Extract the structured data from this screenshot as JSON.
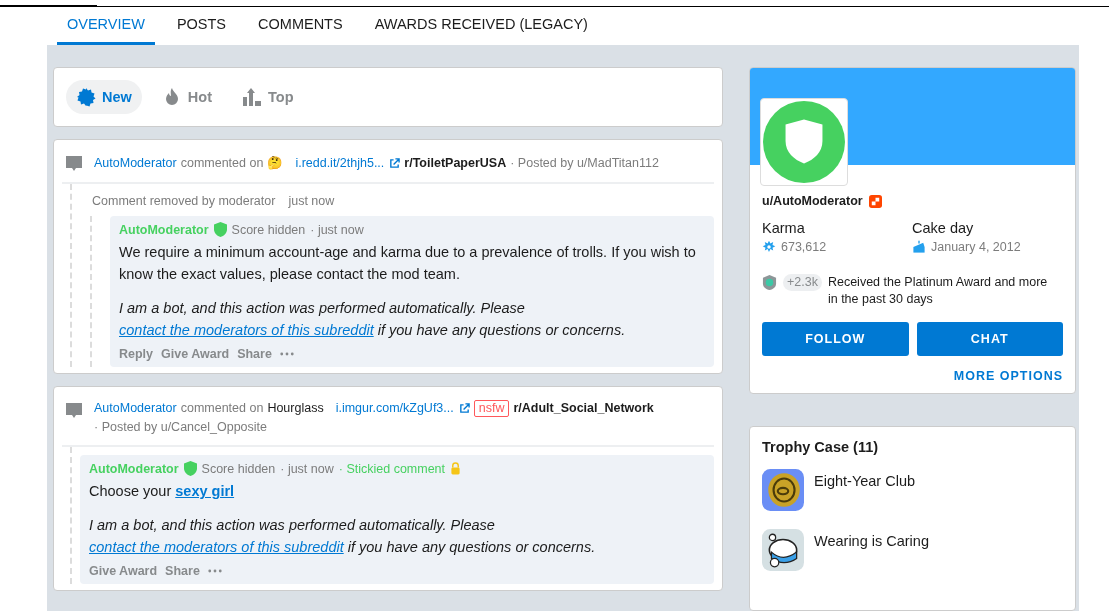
{
  "tabs": [
    {
      "label": "OVERVIEW",
      "selected": true
    },
    {
      "label": "POSTS",
      "selected": false
    },
    {
      "label": "COMMENTS",
      "selected": false
    },
    {
      "label": "AWARDS RECEIVED (LEGACY)",
      "selected": false
    }
  ],
  "sort": [
    {
      "kind": "new",
      "label": "New",
      "selected": true
    },
    {
      "kind": "hot",
      "label": "Hot",
      "selected": false
    },
    {
      "kind": "top",
      "label": "Top",
      "selected": false
    }
  ],
  "comments": [
    {
      "author": "AutoModerator",
      "action": "commented on",
      "post_title": "🤔",
      "link": "i.redd.it/2thjh5...",
      "nsfw": false,
      "subreddit": "r/ToiletPaperUSA",
      "posted_by": "· Posted by u/MadTitan112",
      "removed": {
        "text": "Comment removed by moderator",
        "time": "just now"
      },
      "reply": {
        "author": "AutoModerator",
        "score": "Score hidden",
        "time": "· just now",
        "body": [
          {
            "kind": "text",
            "text": "We require a minimum account-age and karma due to a prevalence of trolls. If you wish to know the exact values, please contact the mod team."
          }
        ],
        "note": [
          {
            "kind": "text",
            "text": "I am a bot, and this action was performed automatically. Please "
          },
          {
            "kind": "link",
            "text": "contact the moderators of this subreddit"
          },
          {
            "kind": "text",
            "text": " if you have any questions or concerns."
          }
        ],
        "actions": [
          "Reply",
          "Give Award",
          "Share"
        ]
      }
    },
    {
      "author": "AutoModerator",
      "action": "commented on",
      "post_title": "Hourglass",
      "link": "i.imgur.com/kZgUf3...",
      "nsfw": true,
      "nsfw_label": "nsfw",
      "subreddit": "r/Adult_Social_Network",
      "posted_by": "· Posted by u/Cancel_Opposite",
      "reply": {
        "author": "AutoModerator",
        "score": "Score hidden",
        "time": "· just now",
        "stickied": "· Stickied comment",
        "body": [
          {
            "kind": "text",
            "text": "Choose your "
          },
          {
            "kind": "link",
            "text": "sexy girl",
            "bold": true
          }
        ],
        "note": [
          {
            "kind": "text",
            "text": "I am a bot, and this action was performed automatically. Please "
          },
          {
            "kind": "link",
            "text": "contact the moderators of this subreddit"
          },
          {
            "kind": "text",
            "text": " if you have any questions or concerns."
          }
        ],
        "actions": [
          "Give Award",
          "Share"
        ]
      }
    }
  ],
  "profile": {
    "username": "u/AutoModerator",
    "karma_label": "Karma",
    "karma": "673,612",
    "cake_label": "Cake day",
    "cake_day": "January 4, 2012",
    "award_count": "+2.3k",
    "award_text": "Received the Platinum Award and more in the past 30 days",
    "buttons": [
      "FOLLOW",
      "CHAT"
    ],
    "more": "MORE OPTIONS"
  },
  "trophies": {
    "title": "Trophy Case (11)",
    "items": [
      {
        "kind": "coin",
        "name": "Eight-Year Club"
      },
      {
        "kind": "mask",
        "name": "Wearing is Caring"
      }
    ]
  }
}
